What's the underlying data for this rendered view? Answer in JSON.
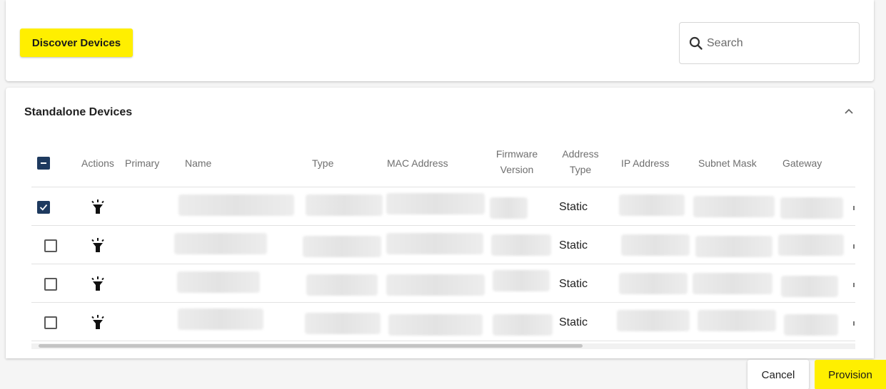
{
  "toolbar": {
    "discover_label": "Discover Devices",
    "search_placeholder": "Search"
  },
  "section": {
    "title": "Standalone Devices"
  },
  "table": {
    "headers": {
      "actions": "Actions",
      "primary": "Primary",
      "name": "Name",
      "type": "Type",
      "mac": "MAC Address",
      "firmware_line1": "Firmware",
      "firmware_line2": "Version",
      "address_type_line1": "Address",
      "address_type_line2": "Type",
      "ip": "IP Address",
      "subnet": "Subnet Mask",
      "gateway": "Gateway"
    },
    "rows": [
      {
        "checked": true,
        "address_type": "Static"
      },
      {
        "checked": false,
        "address_type": "Static"
      },
      {
        "checked": false,
        "address_type": "Static"
      },
      {
        "checked": false,
        "address_type": "Static"
      }
    ]
  },
  "footer": {
    "cancel_label": "Cancel",
    "provision_label": "Provision"
  },
  "colors": {
    "accent_yellow": "#ffef00",
    "checkbox_navy": "#1e3a5f"
  },
  "icons": {
    "search": "search-icon",
    "collapse": "chevron-up-icon",
    "row_action": "flashlight-icon"
  }
}
